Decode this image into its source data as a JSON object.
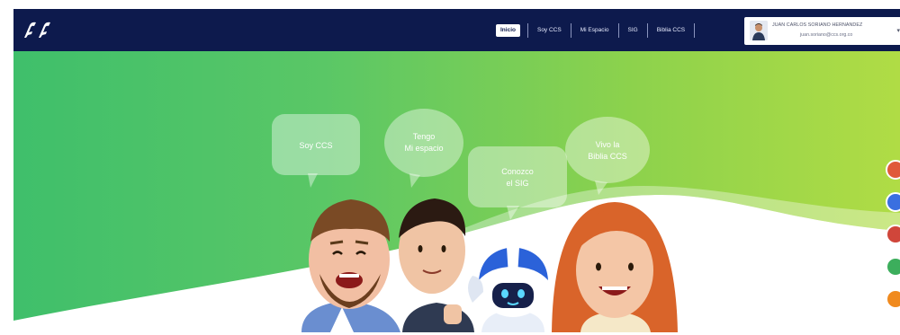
{
  "header": {
    "nav": [
      {
        "label": "Inicio",
        "active": true
      },
      {
        "label": "Soy CCS",
        "active": false
      },
      {
        "label": "Mi Espacio",
        "active": false
      },
      {
        "label": "SIG",
        "active": false
      },
      {
        "label": "Biblia CCS",
        "active": false
      }
    ],
    "user": {
      "name": "JUAN CARLOS SORIANO HERNANDEZ",
      "email": "juan.soriano@ccs.org.co"
    }
  },
  "hero": {
    "bubbles": {
      "soy_ccs": "Soy CCS",
      "tengo_line1": "Tengo",
      "tengo_line2": "Mi espacio",
      "conozco_line1": "Conozco",
      "conozco_line2": "el SIG",
      "vivo_line1": "Vivo la",
      "vivo_line2": "Biblia CCS"
    }
  },
  "floating_buttons": [
    {
      "icon": "app-shortcut-icon",
      "color": "#e05a3a"
    },
    {
      "icon": "app-shortcut-icon",
      "color": "#3a6fe0"
    },
    {
      "icon": "app-shortcut-icon",
      "color": "#d0463a"
    },
    {
      "icon": "app-shortcut-icon",
      "color": "#3cae5c"
    },
    {
      "icon": "app-shortcut-icon",
      "color": "#f08a1e"
    }
  ],
  "colors": {
    "header_bg": "#0d1a4d",
    "hero_start": "#3fbf6b",
    "hero_end": "#b0dc45"
  }
}
